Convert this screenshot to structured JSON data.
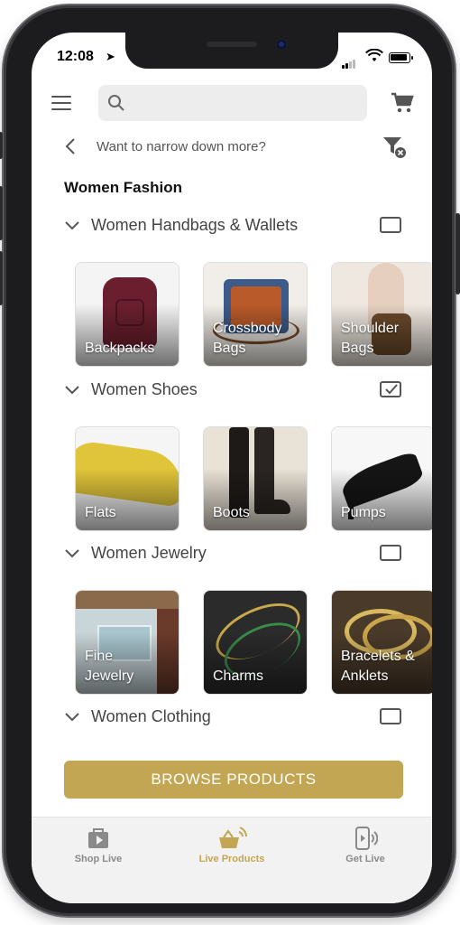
{
  "status_bar": {
    "time": "12:08",
    "location_arrow": "➤"
  },
  "header": {
    "search_placeholder": "",
    "menu_icon": "hamburger-icon",
    "cart_icon": "cart-icon"
  },
  "narrow": {
    "label": "Want to narrow down more?"
  },
  "section_title": "Women Fashion",
  "categories": [
    {
      "name": "Women Handbags & Wallets",
      "checked": false,
      "items": [
        {
          "label": "Backpacks"
        },
        {
          "label": "Crossbody Bags"
        },
        {
          "label": "Shoulder Bags"
        }
      ]
    },
    {
      "name": "Women Shoes",
      "checked": true,
      "items": [
        {
          "label": "Flats"
        },
        {
          "label": "Boots"
        },
        {
          "label": "Pumps"
        }
      ]
    },
    {
      "name": "Women Jewelry",
      "checked": false,
      "items": [
        {
          "label": "Fine Jewelry"
        },
        {
          "label": "Charms"
        },
        {
          "label": "Bracelets & Anklets"
        }
      ]
    },
    {
      "name": "Women Clothing",
      "checked": false,
      "items": []
    }
  ],
  "browse_button": "BROWSE PRODUCTS",
  "tabs": [
    {
      "label": "Shop Live",
      "active": false
    },
    {
      "label": "Live Products",
      "active": true
    },
    {
      "label": "Get Live",
      "active": false
    }
  ],
  "colors": {
    "accent": "#c2a653",
    "tab_inactive": "#8a8a8a"
  }
}
